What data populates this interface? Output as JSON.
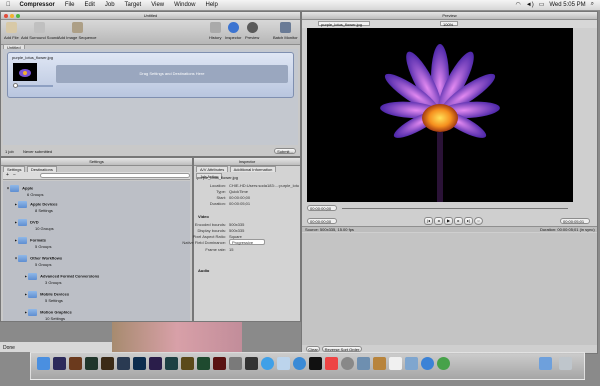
{
  "menubar": {
    "app_name": "Compressor",
    "items": [
      "File",
      "Edit",
      "Job",
      "Target",
      "View",
      "Window",
      "Help"
    ],
    "clock": "Wed 5:05 PM"
  },
  "batch_window": {
    "title": "Untitled",
    "toolbar": {
      "add_file": "Add File",
      "add_surround": "Add Surround Sound",
      "add_image_sequence": "Add Image Sequence",
      "history": "History",
      "inspector": "Inspector",
      "preview": "Preview",
      "batch_monitor": "Batch Monitor"
    },
    "tab": "Untitled",
    "item": {
      "filename": "purple_lotus_flower.jpg",
      "dropzone_text": "Drag Settings and Destinations Here"
    },
    "status_left": "1 job",
    "status_mid": "Never submitted",
    "submit_label": "Submit..."
  },
  "settings_window": {
    "title": "Settings",
    "tabs": [
      "Settings",
      "Destinations"
    ],
    "search_placeholder": "",
    "groups": [
      {
        "name": "Apple",
        "sub": "6 Groups"
      },
      {
        "name": "Apple Devices",
        "sub": "8 Settings"
      },
      {
        "name": "DVD",
        "sub": "10 Groups"
      },
      {
        "name": "Formats",
        "sub": "5 Groups"
      },
      {
        "name": "Other Workflows",
        "sub": "5 Groups"
      },
      {
        "name": "Advanced Format Conversions",
        "sub": "3 Groups"
      },
      {
        "name": "Mobile Devices",
        "sub": "5 Settings"
      },
      {
        "name": "Motion Graphics",
        "sub": "10 Settings"
      }
    ]
  },
  "inspector_window": {
    "title": "Inspector",
    "tabs": [
      "A/V Attributes",
      "Additional Information",
      "Job Action"
    ],
    "filename": "purple_lotus_flower.jpg",
    "fields": [
      {
        "label": "Location:",
        "value": "CHIE-HD:Users:soda183:...:purple_lotus_flower.jpg"
      },
      {
        "label": "Type:",
        "value": "QuickTime"
      },
      {
        "label": "Start:",
        "value": "00:00:00;00"
      },
      {
        "label": "Duration:",
        "value": "00:00:05;01"
      }
    ],
    "video_heading": "Video",
    "video_fields": [
      {
        "label": "Encoded bounds:",
        "value": "500x335"
      },
      {
        "label": "Display bounds:",
        "value": "500x335"
      },
      {
        "label": "Pixel Aspect Ratio:",
        "value": "Square"
      },
      {
        "label": "Native Field Dominance:",
        "value": "Progressive"
      },
      {
        "label": "Frame rate:",
        "value": "15"
      }
    ],
    "audio_heading": "Audio"
  },
  "preview_window": {
    "title": "Preview",
    "file_dropdown": "purple_lotus_flower.jpg",
    "zoom_dropdown": "100%",
    "timecode_start": "00:00:00;00",
    "timecode_in": "00:00:00;00",
    "timecode_out": "00:00:05;01",
    "timecode_duration": "00:00:00;00",
    "status_source": "Source: 500x335, 15.00 fps",
    "status_duration": "Duration: 00:00:05;01 (in sync)",
    "clear_label": "Clear",
    "reverse_label": "Reverse Sort Order"
  },
  "status_bar": {
    "text": "Done"
  },
  "dock": {
    "icons": [
      "finder-icon",
      "after-effects-icon",
      "bridge-icon",
      "encore-icon",
      "illustrator-icon",
      "lightroom-icon",
      "photoshop-icon",
      "premiere-icon",
      "soundbooth-icon",
      "fireworks-icon",
      "dreamweaver-icon",
      "flash-icon",
      "compressor-icon",
      "final-cut-icon",
      "itunes-icon",
      "mail-icon",
      "safari-icon",
      "terminal-icon",
      "ical-icon",
      "system-preferences-icon",
      "grab-icon",
      "address-book-icon",
      "textedit-icon",
      "preview-icon",
      "app-store-icon",
      "ichat-icon",
      "folder-icon",
      "trash-icon"
    ]
  }
}
